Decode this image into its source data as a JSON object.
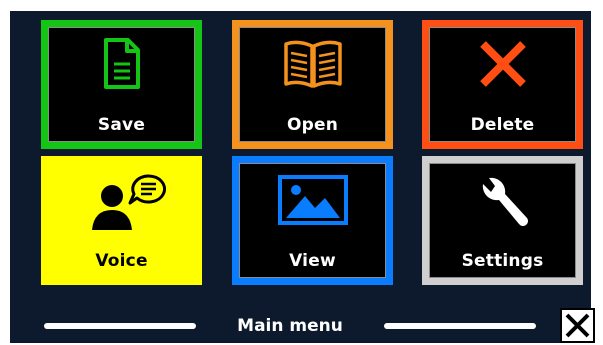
{
  "menu": {
    "title": "Main menu",
    "tiles": [
      {
        "label": "Save",
        "icon": "document-icon",
        "color": "#15c515"
      },
      {
        "label": "Open",
        "icon": "book-icon",
        "color": "#f5921e"
      },
      {
        "label": "Delete",
        "icon": "x-icon",
        "color": "#ff4e14"
      },
      {
        "label": "Voice",
        "icon": "speaking-person-icon",
        "color": "#ffff00"
      },
      {
        "label": "View",
        "icon": "image-icon",
        "color": "#0a7dff"
      },
      {
        "label": "Settings",
        "icon": "wrench-icon",
        "color": "#cfcfcf"
      }
    ]
  },
  "close_button": {
    "icon": "close-icon"
  },
  "colors": {
    "background": "#0d1a2e",
    "text": "#ffffff"
  }
}
